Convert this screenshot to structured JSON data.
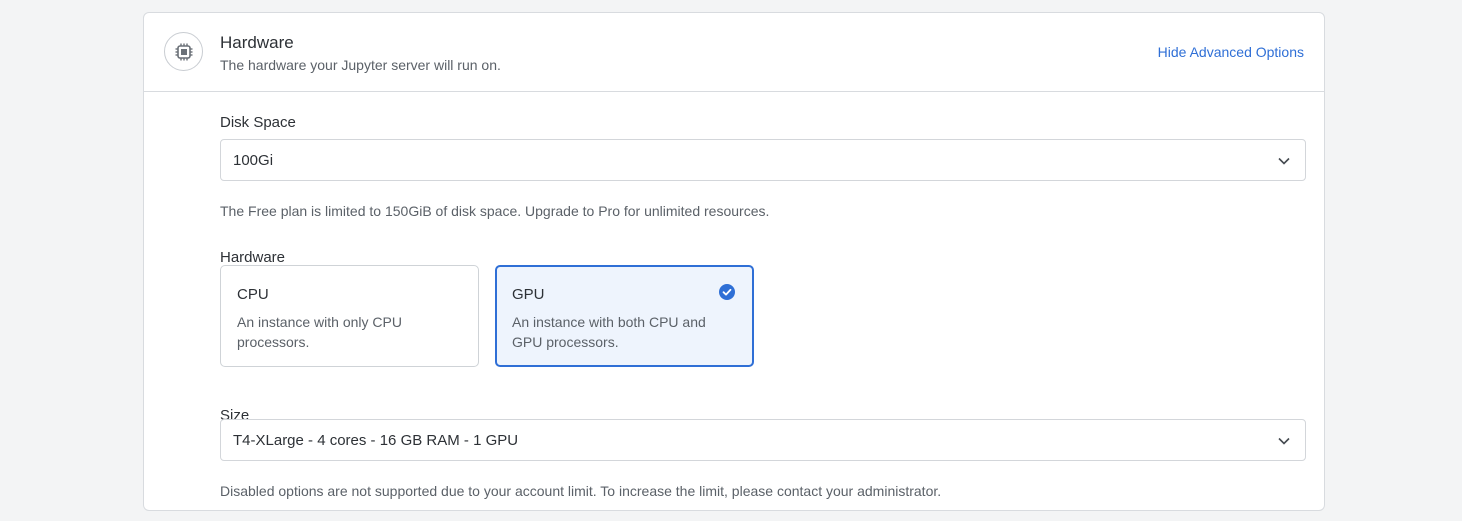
{
  "header": {
    "icon": "cpu-chip-icon",
    "title": "Hardware",
    "subtitle": "The hardware your Jupyter server will run on.",
    "advanced_link": "Hide Advanced Options"
  },
  "disk": {
    "label": "Disk Space",
    "value": "100Gi",
    "help": "The Free plan is limited to 150GiB of disk space. Upgrade to Pro for unlimited resources."
  },
  "hardware": {
    "label": "Hardware",
    "options": [
      {
        "title": "CPU",
        "description": "An instance with only CPU processors.",
        "selected": false
      },
      {
        "title": "GPU",
        "description": "An instance with both CPU and GPU processors.",
        "selected": true
      }
    ]
  },
  "size": {
    "label": "Size",
    "value": "T4-XLarge - 4 cores - 16 GB RAM - 1 GPU",
    "help": "Disabled options are not supported due to your account limit. To increase the limit, please contact your administrator."
  },
  "colors": {
    "accent": "#2f6fd6",
    "selected_bg": "#eef4fd",
    "border": "#d8dbdf"
  }
}
